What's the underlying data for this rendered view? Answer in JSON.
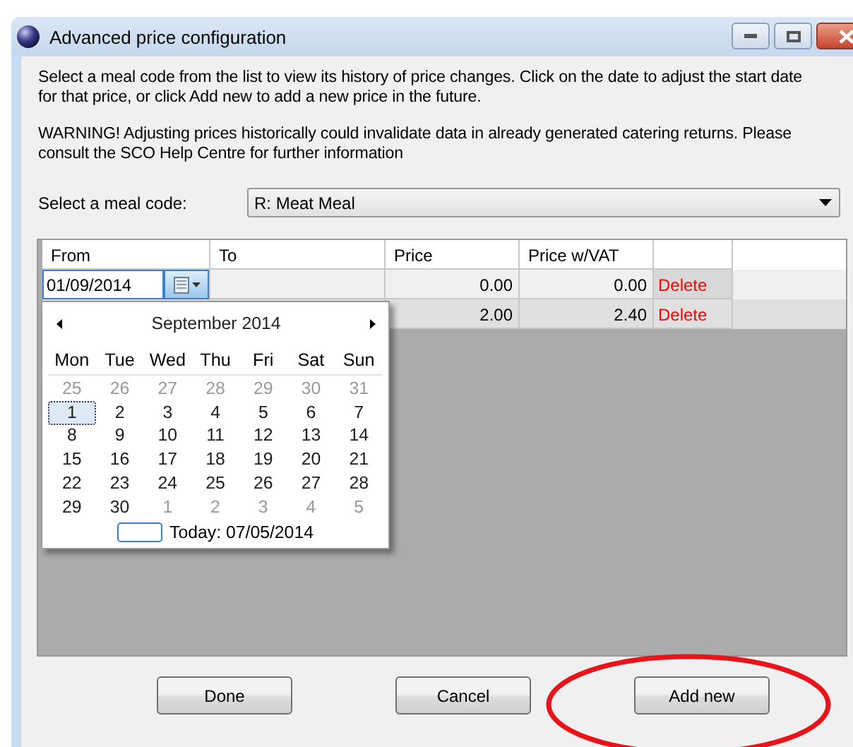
{
  "window": {
    "title": "Advanced price configuration"
  },
  "instructions": [
    "Select a meal code from the list to view its history of price changes. Click on the date to adjust the start date for that price, or click Add new to add a new price in the future.",
    "WARNING! Adjusting prices historically could invalidate data in already generated catering returns. Please consult the SCO Help Centre for further information"
  ],
  "meal_code": {
    "label": "Select a meal code:",
    "value": "R: Meat Meal"
  },
  "grid": {
    "columns": [
      "From",
      "To",
      "Price",
      "Price w/VAT"
    ],
    "rows": [
      {
        "from": "01/09/2014",
        "price": "0.00",
        "price_vat": "0.00",
        "action": "Delete"
      },
      {
        "price": "2.00",
        "price_vat": "2.40",
        "action": "Delete"
      }
    ]
  },
  "calendar": {
    "month": "September 2014",
    "weekdays": [
      "Mon",
      "Tue",
      "Wed",
      "Thu",
      "Fri",
      "Sat",
      "Sun"
    ],
    "weeks": [
      [
        {
          "day": "25",
          "other_month": true,
          "selected": false
        },
        {
          "day": "26",
          "other_month": true,
          "selected": false
        },
        {
          "day": "27",
          "other_month": true,
          "selected": false
        },
        {
          "day": "28",
          "other_month": true,
          "selected": false
        },
        {
          "day": "29",
          "other_month": true,
          "selected": false
        },
        {
          "day": "30",
          "other_month": true,
          "selected": false
        },
        {
          "day": "31",
          "other_month": true,
          "selected": false
        }
      ],
      [
        {
          "day": "1",
          "other_month": false,
          "selected": true
        },
        {
          "day": "2",
          "other_month": false,
          "selected": false
        },
        {
          "day": "3",
          "other_month": false,
          "selected": false
        },
        {
          "day": "4",
          "other_month": false,
          "selected": false
        },
        {
          "day": "5",
          "other_month": false,
          "selected": false
        },
        {
          "day": "6",
          "other_month": false,
          "selected": false
        },
        {
          "day": "7",
          "other_month": false,
          "selected": false
        }
      ],
      [
        {
          "day": "8",
          "other_month": false,
          "selected": false
        },
        {
          "day": "9",
          "other_month": false,
          "selected": false
        },
        {
          "day": "10",
          "other_month": false,
          "selected": false
        },
        {
          "day": "11",
          "other_month": false,
          "selected": false
        },
        {
          "day": "12",
          "other_month": false,
          "selected": false
        },
        {
          "day": "13",
          "other_month": false,
          "selected": false
        },
        {
          "day": "14",
          "other_month": false,
          "selected": false
        }
      ],
      [
        {
          "day": "15",
          "other_month": false,
          "selected": false
        },
        {
          "day": "16",
          "other_month": false,
          "selected": false
        },
        {
          "day": "17",
          "other_month": false,
          "selected": false
        },
        {
          "day": "18",
          "other_month": false,
          "selected": false
        },
        {
          "day": "19",
          "other_month": false,
          "selected": false
        },
        {
          "day": "20",
          "other_month": false,
          "selected": false
        },
        {
          "day": "21",
          "other_month": false,
          "selected": false
        }
      ],
      [
        {
          "day": "22",
          "other_month": false,
          "selected": false
        },
        {
          "day": "23",
          "other_month": false,
          "selected": false
        },
        {
          "day": "24",
          "other_month": false,
          "selected": false
        },
        {
          "day": "25",
          "other_month": false,
          "selected": false
        },
        {
          "day": "26",
          "other_month": false,
          "selected": false
        },
        {
          "day": "27",
          "other_month": false,
          "selected": false
        },
        {
          "day": "28",
          "other_month": false,
          "selected": false
        }
      ],
      [
        {
          "day": "29",
          "other_month": false,
          "selected": false
        },
        {
          "day": "30",
          "other_month": false,
          "selected": false
        },
        {
          "day": "1",
          "other_month": true,
          "selected": false
        },
        {
          "day": "2",
          "other_month": true,
          "selected": false
        },
        {
          "day": "3",
          "other_month": true,
          "selected": false
        },
        {
          "day": "4",
          "other_month": true,
          "selected": false
        },
        {
          "day": "5",
          "other_month": true,
          "selected": false
        }
      ]
    ],
    "today": "Today: 07/05/2014"
  },
  "buttons": [
    "Done",
    "Cancel",
    "Add new"
  ]
}
